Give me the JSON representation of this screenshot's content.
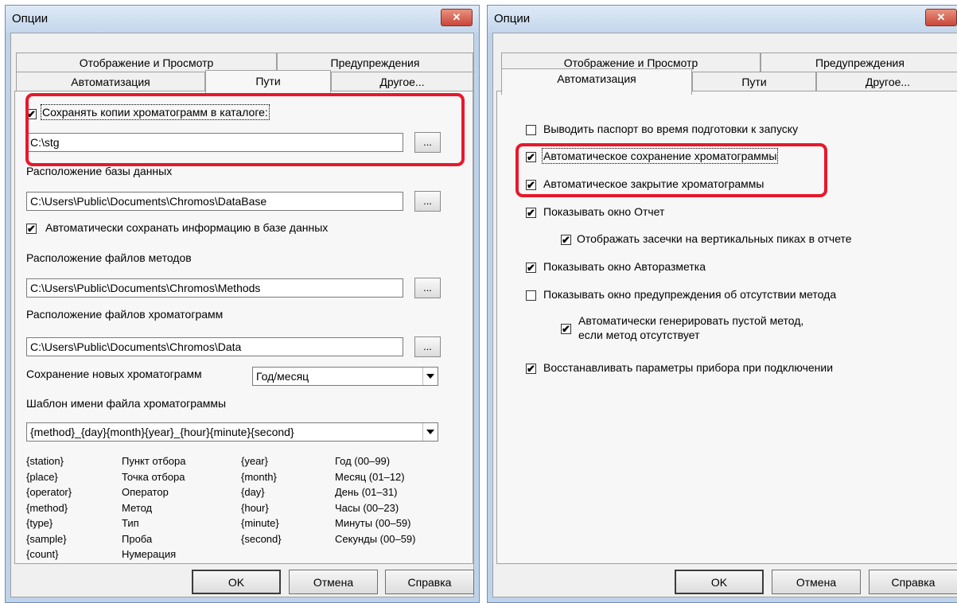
{
  "dialog1": {
    "title": "Опции",
    "close_glyph": "✕",
    "tabs": {
      "display_view": "Отображение и Просмотр",
      "warnings": "Предупреждения",
      "automation": "Автоматизация",
      "paths": "Пути",
      "other": "Другое..."
    },
    "save_copies": {
      "label": "Сохранять копии хроматограмм в каталоге:",
      "checked": true,
      "path": "C:\\stg"
    },
    "db": {
      "label": "Расположение базы данных",
      "path": "C:\\Users\\Public\\Documents\\Chromos\\DataBase"
    },
    "auto_save_db": {
      "label": "Автоматически сохранать информацию в базе данных",
      "checked": true
    },
    "methods": {
      "label": "Расположение файлов методов",
      "path": "C:\\Users\\Public\\Documents\\Chromos\\Methods"
    },
    "chroms": {
      "label": "Расположение файлов хроматограмм",
      "path": "C:\\Users\\Public\\Documents\\Chromos\\Data"
    },
    "saving_new": {
      "label": "Сохранение новых хроматограмм",
      "value": "Год/месяц"
    },
    "template": {
      "label": "Шаблон имени файла хроматограммы",
      "value": "{method}_{day}{month}{year}_{hour}{minute}{second}"
    },
    "browse_label": "...",
    "legend_left": [
      {
        "token": "{station}",
        "desc": "Пункт отбора"
      },
      {
        "token": "{place}",
        "desc": "Точка отбора"
      },
      {
        "token": "{operator}",
        "desc": "Оператор"
      },
      {
        "token": "{method}",
        "desc": "Метод"
      },
      {
        "token": "{type}",
        "desc": "Тип"
      },
      {
        "token": "{sample}",
        "desc": "Проба"
      },
      {
        "token": "{count}",
        "desc": "Нумерация"
      }
    ],
    "legend_right": [
      {
        "token": "{year}",
        "desc": "Год (00–99)"
      },
      {
        "token": "{month}",
        "desc": "Месяц (01–12)"
      },
      {
        "token": "{day}",
        "desc": "День (01–31)"
      },
      {
        "token": "{hour}",
        "desc": "Часы (00–23)"
      },
      {
        "token": "{minute}",
        "desc": "Минуты (00–59)"
      },
      {
        "token": "{second}",
        "desc": "Секунды (00–59)"
      }
    ],
    "buttons": {
      "ok": "OK",
      "cancel": "Отмена",
      "help": "Справка"
    }
  },
  "dialog2": {
    "title": "Опции",
    "close_glyph": "✕",
    "tabs": {
      "display_view": "Отображение и Просмотр",
      "warnings": "Предупреждения",
      "automation": "Автоматизация",
      "paths": "Пути",
      "other": "Другое..."
    },
    "options": [
      {
        "label": "Выводить паспорт во время подготовки к запуску",
        "checked": false
      },
      {
        "label": "Автоматическое сохранение хроматограммы",
        "checked": true
      },
      {
        "label": "Автоматическое закрытие хроматограммы",
        "checked": true
      },
      {
        "label": "Показывать окно Отчет",
        "checked": true
      },
      {
        "label": "Отображать засечки на вертикальных пиках в отчете",
        "checked": true
      },
      {
        "label": "Показывать окно Авторазметка",
        "checked": true
      },
      {
        "label": "Показывать окно предупреждения об отсутствии метода",
        "checked": false
      },
      {
        "label": "Автоматически генерировать пустой метод,",
        "label2": "если метод отсутствует",
        "checked": true
      },
      {
        "label": "Восстанавливать параметры прибора при подключении",
        "checked": true
      }
    ],
    "buttons": {
      "ok": "OK",
      "cancel": "Отмена",
      "help": "Справка"
    }
  },
  "check_glyph": "✔"
}
